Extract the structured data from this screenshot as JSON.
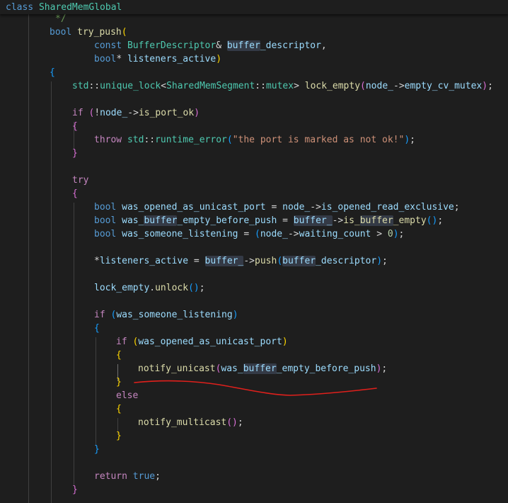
{
  "sticky_header": {
    "tokens": [
      {
        "t": "class",
        "c": "kw"
      },
      {
        "t": " ",
        "c": "tx"
      },
      {
        "t": "SharedMemGlobal",
        "c": "ty"
      }
    ]
  },
  "code_lines": [
    [
      {
        "t": "*/",
        "c": "cm"
      }
    ],
    [
      {
        "t": "bool",
        "c": "kw"
      },
      {
        "t": " ",
        "c": "tx"
      },
      {
        "t": "try_push",
        "c": "fn"
      },
      {
        "t": "(",
        "c": "b1"
      }
    ],
    [
      {
        "t": "const",
        "c": "kw"
      },
      {
        "t": " ",
        "c": "tx"
      },
      {
        "t": "BufferDescriptor",
        "c": "ty"
      },
      {
        "t": "& ",
        "c": "tx"
      },
      {
        "t": "buffer",
        "c": "vr",
        "hl": true
      },
      {
        "t": "_descriptor",
        "c": "vr"
      },
      {
        "t": ",",
        "c": "tx"
      }
    ],
    [
      {
        "t": "bool",
        "c": "kw"
      },
      {
        "t": "* ",
        "c": "tx"
      },
      {
        "t": "listeners_active",
        "c": "vr"
      },
      {
        "t": ")",
        "c": "b1"
      }
    ],
    [
      {
        "t": "{",
        "c": "b3"
      }
    ],
    [
      {
        "t": "std",
        "c": "ty"
      },
      {
        "t": "::",
        "c": "tx"
      },
      {
        "t": "unique_lock",
        "c": "ty"
      },
      {
        "t": "<",
        "c": "tx"
      },
      {
        "t": "SharedMemSegment",
        "c": "ty"
      },
      {
        "t": "::",
        "c": "tx"
      },
      {
        "t": "mutex",
        "c": "ty"
      },
      {
        "t": "> ",
        "c": "tx"
      },
      {
        "t": "lock_empty",
        "c": "fn"
      },
      {
        "t": "(",
        "c": "b2"
      },
      {
        "t": "node_",
        "c": "vr"
      },
      {
        "t": "->",
        "c": "tx"
      },
      {
        "t": "empty_cv_mutex",
        "c": "vr"
      },
      {
        "t": ")",
        "c": "b2"
      },
      {
        "t": ";",
        "c": "tx"
      }
    ],
    [],
    [
      {
        "t": "if",
        "c": "ctl"
      },
      {
        "t": " ",
        "c": "tx"
      },
      {
        "t": "(",
        "c": "b2"
      },
      {
        "t": "!",
        "c": "tx"
      },
      {
        "t": "node_",
        "c": "vr"
      },
      {
        "t": "->",
        "c": "tx"
      },
      {
        "t": "is_port_ok",
        "c": "fn"
      },
      {
        "t": ")",
        "c": "b2"
      }
    ],
    [
      {
        "t": "{",
        "c": "b2"
      }
    ],
    [
      {
        "t": "throw",
        "c": "ctl"
      },
      {
        "t": " ",
        "c": "tx"
      },
      {
        "t": "std",
        "c": "ty"
      },
      {
        "t": "::",
        "c": "tx"
      },
      {
        "t": "runtime_error",
        "c": "ty"
      },
      {
        "t": "(",
        "c": "b3"
      },
      {
        "t": "\"the port is marked as not ok!\"",
        "c": "st"
      },
      {
        "t": ")",
        "c": "b3"
      },
      {
        "t": ";",
        "c": "tx"
      }
    ],
    [
      {
        "t": "}",
        "c": "b2"
      }
    ],
    [],
    [
      {
        "t": "try",
        "c": "ctl"
      }
    ],
    [
      {
        "t": "{",
        "c": "b2"
      }
    ],
    [
      {
        "t": "bool",
        "c": "kw"
      },
      {
        "t": " ",
        "c": "tx"
      },
      {
        "t": "was_opened_as_unicast_port",
        "c": "vr"
      },
      {
        "t": " = ",
        "c": "tx"
      },
      {
        "t": "node_",
        "c": "vr"
      },
      {
        "t": "->",
        "c": "tx"
      },
      {
        "t": "is_opened_read_exclusive",
        "c": "vr"
      },
      {
        "t": ";",
        "c": "tx"
      }
    ],
    [
      {
        "t": "bool",
        "c": "kw"
      },
      {
        "t": " ",
        "c": "tx"
      },
      {
        "t": "was_",
        "c": "vr"
      },
      {
        "t": "buffer",
        "c": "vr",
        "hl": true
      },
      {
        "t": "_empty_before_push",
        "c": "vr"
      },
      {
        "t": " = ",
        "c": "tx"
      },
      {
        "t": "buffer_",
        "c": "vr",
        "hl": true
      },
      {
        "t": "->",
        "c": "tx"
      },
      {
        "t": "is_",
        "c": "fn"
      },
      {
        "t": "buffer",
        "c": "fn",
        "hl": true
      },
      {
        "t": "_empty",
        "c": "fn"
      },
      {
        "t": "()",
        "c": "b3"
      },
      {
        "t": ";",
        "c": "tx"
      }
    ],
    [
      {
        "t": "bool",
        "c": "kw"
      },
      {
        "t": " ",
        "c": "tx"
      },
      {
        "t": "was_someone_listening",
        "c": "vr"
      },
      {
        "t": " = ",
        "c": "tx"
      },
      {
        "t": "(",
        "c": "b3"
      },
      {
        "t": "node_",
        "c": "vr"
      },
      {
        "t": "->",
        "c": "tx"
      },
      {
        "t": "waiting_count",
        "c": "vr"
      },
      {
        "t": " > ",
        "c": "tx"
      },
      {
        "t": "0",
        "c": "nm"
      },
      {
        "t": ")",
        "c": "b3"
      },
      {
        "t": ";",
        "c": "tx"
      }
    ],
    [],
    [
      {
        "t": "*",
        "c": "tx"
      },
      {
        "t": "listeners_active",
        "c": "vr"
      },
      {
        "t": " = ",
        "c": "tx"
      },
      {
        "t": "buffer_",
        "c": "vr",
        "hl": true
      },
      {
        "t": "->",
        "c": "tx"
      },
      {
        "t": "push",
        "c": "fn"
      },
      {
        "t": "(",
        "c": "b3"
      },
      {
        "t": "buffer",
        "c": "vr",
        "hl": true
      },
      {
        "t": "_descriptor",
        "c": "vr"
      },
      {
        "t": ")",
        "c": "b3"
      },
      {
        "t": ";",
        "c": "tx"
      }
    ],
    [],
    [
      {
        "t": "lock_empty",
        "c": "vr"
      },
      {
        "t": ".",
        "c": "tx"
      },
      {
        "t": "unlock",
        "c": "fn"
      },
      {
        "t": "()",
        "c": "b3"
      },
      {
        "t": ";",
        "c": "tx"
      }
    ],
    [],
    [
      {
        "t": "if",
        "c": "ctl"
      },
      {
        "t": " ",
        "c": "tx"
      },
      {
        "t": "(",
        "c": "b3"
      },
      {
        "t": "was_someone_listening",
        "c": "vr"
      },
      {
        "t": ")",
        "c": "b3"
      }
    ],
    [
      {
        "t": "{",
        "c": "b3"
      }
    ],
    [
      {
        "t": "if",
        "c": "ctl"
      },
      {
        "t": " ",
        "c": "tx"
      },
      {
        "t": "(",
        "c": "b1"
      },
      {
        "t": "was_opened_as_unicast_port",
        "c": "vr"
      },
      {
        "t": ")",
        "c": "b1"
      }
    ],
    [
      {
        "t": "{",
        "c": "b1"
      }
    ],
    [
      {
        "t": "notify_unicast",
        "c": "fn"
      },
      {
        "t": "(",
        "c": "b2"
      },
      {
        "t": "was_",
        "c": "vr"
      },
      {
        "t": "buffer",
        "c": "vr",
        "hl": true
      },
      {
        "t": "_empty_before_push",
        "c": "vr"
      },
      {
        "t": ")",
        "c": "b2"
      },
      {
        "t": ";",
        "c": "tx"
      }
    ],
    [
      {
        "t": "}",
        "c": "b1"
      }
    ],
    [
      {
        "t": "else",
        "c": "ctl"
      }
    ],
    [
      {
        "t": "{",
        "c": "b1"
      }
    ],
    [
      {
        "t": "notify_multicast",
        "c": "fn"
      },
      {
        "t": "()",
        "c": "b2"
      },
      {
        "t": ";",
        "c": "tx"
      }
    ],
    [
      {
        "t": "}",
        "c": "b1"
      }
    ],
    [
      {
        "t": "}",
        "c": "b3"
      }
    ],
    [],
    [
      {
        "t": "return",
        "c": "ctl"
      },
      {
        "t": " ",
        "c": "tx"
      },
      {
        "t": "true",
        "c": "kw"
      },
      {
        "t": ";",
        "c": "tx"
      }
    ],
    [
      {
        "t": "}",
        "c": "b2"
      }
    ]
  ],
  "colors": {
    "background": "#1e1e1e",
    "keyword": "#569cd6",
    "type": "#4ec9b0",
    "function": "#dcdcaa",
    "variable": "#9cdcfe",
    "string": "#ce9178",
    "number": "#b5cea8",
    "control": "#c586c0",
    "comment": "#6a9955",
    "word_highlight": "#343a46",
    "annotation_stroke": "#e0201c"
  },
  "annotation": {
    "kind": "freehand-underline",
    "target": "notify_unicast"
  }
}
